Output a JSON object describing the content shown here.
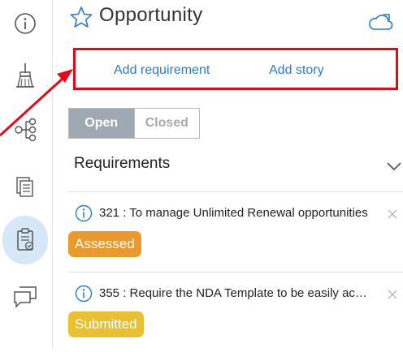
{
  "header": {
    "title": "Opportunity",
    "star_icon": "star-outline-icon",
    "cloud_icon": "cloud-icon",
    "accent": "#2a7bd0"
  },
  "rail": {
    "items": [
      {
        "icon": "info-icon"
      },
      {
        "icon": "broom-icon"
      },
      {
        "icon": "hierarchy-icon"
      },
      {
        "icon": "documents-icon"
      },
      {
        "icon": "clipboard-check-icon",
        "active": true
      },
      {
        "icon": "chat-icon"
      }
    ],
    "active_color": "#d6e8f8"
  },
  "actions": {
    "add_requirement": "Add requirement",
    "add_story": "Add story",
    "highlight_color": "#e3091a"
  },
  "toggle": {
    "open": "Open",
    "closed": "Closed",
    "selected": "Open"
  },
  "requirements": {
    "title": "Requirements",
    "items": [
      {
        "text": "321 : To manage Unlimited Renewal opportunities",
        "status": "Assessed",
        "status_color": "#ea9a2c"
      },
      {
        "text": "355 : Require the NDA Template to be easily acce…",
        "status": "Submitted",
        "status_color": "#e9c02f"
      }
    ]
  }
}
